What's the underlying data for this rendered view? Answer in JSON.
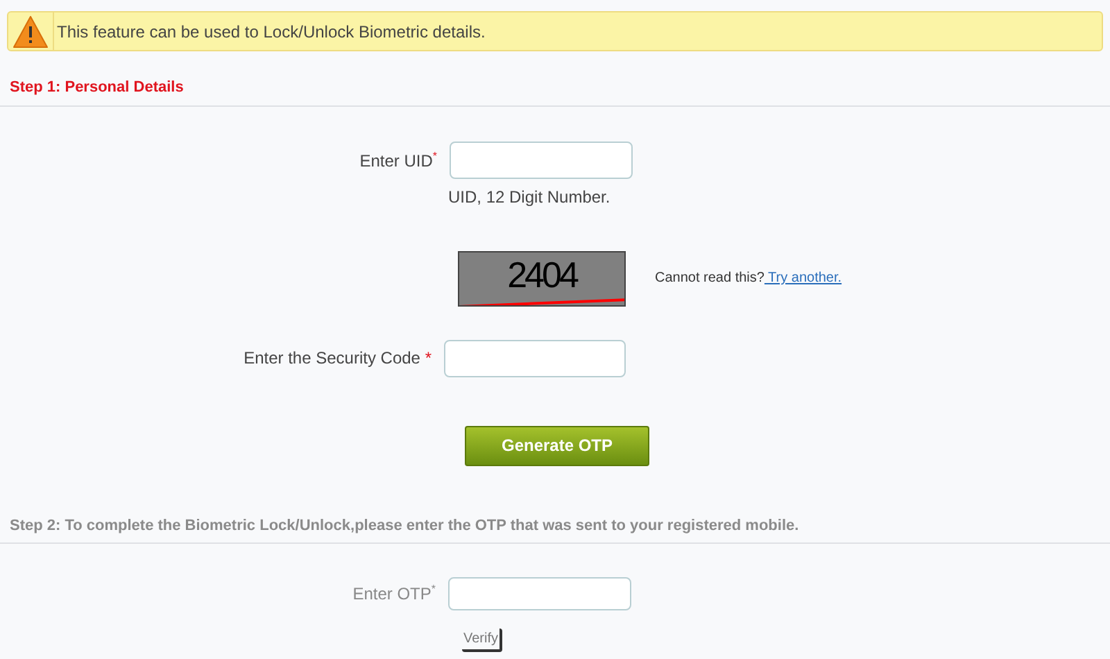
{
  "alert": {
    "text": "This feature can be used to Lock/Unlock Biometric details."
  },
  "step1": {
    "heading": "Step 1: Personal Details",
    "uid": {
      "label": "Enter UID",
      "required": "*",
      "hint": "UID, 12 Digit Number."
    },
    "captcha": {
      "code": "2404",
      "prompt": "Cannot read this?",
      "link": " Try another."
    },
    "security": {
      "label": "Enter the Security Code",
      "required": "*"
    },
    "button": "Generate OTP"
  },
  "step2": {
    "heading": "Step 2: To complete the Biometric Lock/Unlock,please enter the OTP that was sent to your registered mobile.",
    "disabled": true,
    "otp": {
      "label": "Enter OTP",
      "required": "*"
    },
    "verify": "Verify"
  }
}
